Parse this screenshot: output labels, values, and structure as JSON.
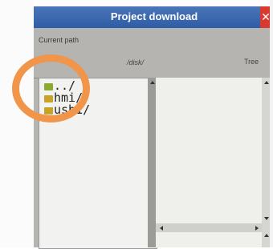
{
  "dialog": {
    "title": "Project download",
    "close_icon": "close-icon",
    "current_path_label": "Current path",
    "current_path_value": "/disk/",
    "tree_label": "Tree"
  },
  "files": [
    {
      "name": "../",
      "icon": "folder-up-icon"
    },
    {
      "name": "hmi/",
      "icon": "folder-icon"
    },
    {
      "name": "usb1/",
      "icon": "folder-icon"
    }
  ],
  "colors": {
    "titlebar": "#2e5ca6",
    "close_button": "#d93a2f",
    "highlight": "#f0954a",
    "dialog_bg": "#b5b4b1"
  }
}
